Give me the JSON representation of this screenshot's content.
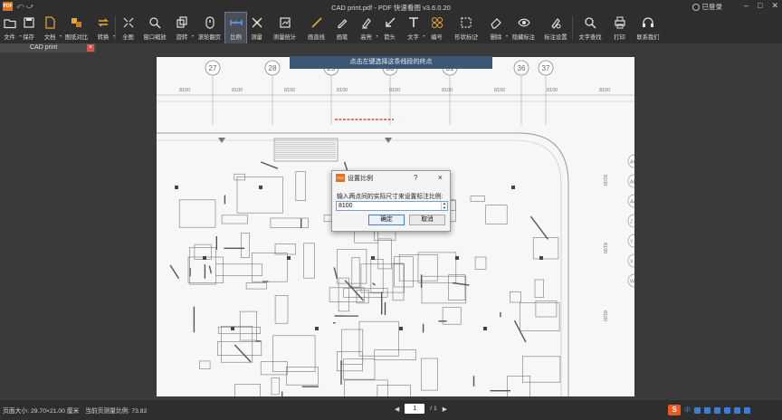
{
  "titlebar": {
    "logo_text": "PDF",
    "quick_actions": "⤺ ⤻",
    "title": "CAD print.pdf - PDF 快速看图 v3.6.0.20",
    "login": "已登录"
  },
  "toolbar": [
    {
      "id": "file",
      "label": "文件",
      "icon": "folder-icon",
      "dropdown": true
    },
    {
      "id": "save",
      "label": "保存",
      "icon": "save-icon"
    },
    {
      "id": "doc",
      "label": "文档",
      "icon": "document-icon",
      "dropdown": true
    },
    {
      "id": "compare",
      "label": "图纸对比",
      "icon": "compare-icon"
    },
    {
      "id": "convert",
      "label": "转换",
      "icon": "convert-icon",
      "dropdown": true
    },
    {
      "id": "fullview",
      "label": "全图",
      "icon": "fit-icon"
    },
    {
      "id": "zoomwin",
      "label": "窗口缩放",
      "icon": "zoom-window-icon"
    },
    {
      "id": "rotate",
      "label": "旋转",
      "icon": "rotate-icon",
      "dropdown": true
    },
    {
      "id": "scroll",
      "label": "滚轮翻页",
      "icon": "scroll-wheel-icon"
    },
    {
      "id": "scale",
      "label": "比例",
      "icon": "scale-icon",
      "active": true
    },
    {
      "id": "measure",
      "label": "测量",
      "icon": "measure-icon"
    },
    {
      "id": "measurestats",
      "label": "测量统计",
      "icon": "measure-stats-icon"
    },
    {
      "id": "line",
      "label": "画直线",
      "icon": "line-icon"
    },
    {
      "id": "pen",
      "label": "画笔",
      "icon": "pen-icon"
    },
    {
      "id": "highlight",
      "label": "高亮",
      "icon": "highlight-icon",
      "dropdown": true
    },
    {
      "id": "arrow",
      "label": "箭头",
      "icon": "arrow-icon"
    },
    {
      "id": "text",
      "label": "文字",
      "icon": "text-icon",
      "dropdown": true
    },
    {
      "id": "number",
      "label": "编号",
      "icon": "number-icon"
    },
    {
      "id": "shape",
      "label": "形状标记",
      "icon": "shape-icon",
      "dropdown": true
    },
    {
      "id": "delete",
      "label": "删除",
      "icon": "eraser-icon",
      "dropdown": true
    },
    {
      "id": "hide",
      "label": "隐藏标注",
      "icon": "eye-icon"
    },
    {
      "id": "annosettings",
      "label": "标注设置",
      "icon": "annotation-settings-icon"
    },
    {
      "id": "findtext",
      "label": "文字查找",
      "icon": "search-icon"
    },
    {
      "id": "print",
      "label": "打印",
      "icon": "print-icon"
    },
    {
      "id": "contact",
      "label": "联系我们",
      "icon": "headset-icon"
    }
  ],
  "tab": {
    "label": "CAD print",
    "close": "×"
  },
  "hint": "点击左键选择这条线段的终点",
  "dialog": {
    "title": "设置比例",
    "help": "?",
    "close": "×",
    "prompt": "输入两点间的实际尺寸来设置标注比例:",
    "value": "8100",
    "ok": "确定",
    "cancel": "取消"
  },
  "drawing": {
    "grid_labels": [
      "27",
      "28",
      "29",
      "30",
      "31",
      "32",
      "33",
      "34",
      "35",
      "36",
      "37"
    ],
    "dimension_labels": [
      "8100",
      "8100",
      "8100",
      "8100",
      "8100",
      "8100",
      "8100",
      "8100",
      "8100"
    ],
    "side_labels_right": [
      "8100",
      "8100",
      "8100"
    ],
    "axis_right": [
      "AC",
      "AB",
      "AA",
      "Z",
      "Y",
      "X",
      "W"
    ]
  },
  "statusbar": {
    "page_size": "页面大小: 29.70×21.00 厘米",
    "scale": "当前页测量比例: 73.82",
    "current_page": "1",
    "total_pages": "/ 1"
  },
  "tray": {
    "ime": "中",
    "ime_logo": "S"
  },
  "colors": {
    "accent": "#e0741d",
    "hint_bg": "#3d5876",
    "active_tool": "#4a4f57",
    "measure_line": "#e0262a"
  }
}
